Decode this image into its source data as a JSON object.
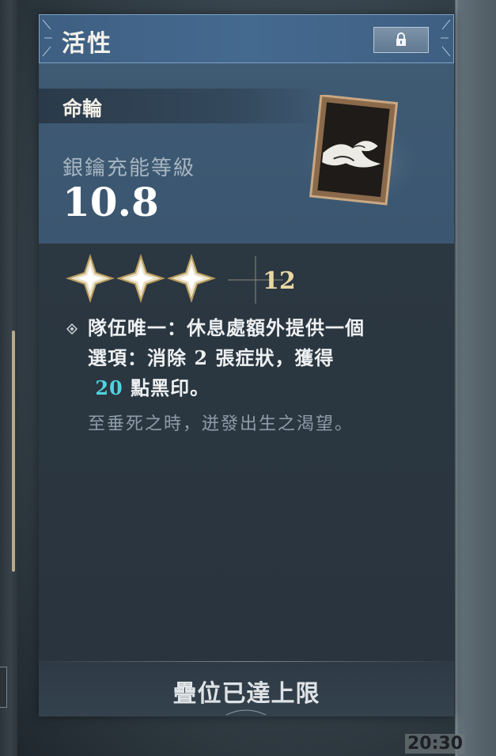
{
  "card": {
    "title": "活性",
    "type_label": "命輪",
    "charge_label": "銀鑰充能等級",
    "charge_value": "10.8",
    "stars": {
      "filled": 3,
      "count_label": "12"
    },
    "effect": {
      "line1": "隊伍唯一：休息處額外提供一個",
      "line2_a": "選項：消除 ",
      "line2_num": "2",
      "line2_b": " 張症狀，獲得",
      "line3_num": "20",
      "line3_b": " 點黑印。"
    },
    "flavor": "至垂死之時，迸發出生之渴望。",
    "footer": "疊位已達上限"
  },
  "icons": {
    "lock": "lock-icon",
    "frame": "framed-wave-painting-icon",
    "star": "four-point-star-icon",
    "bullet": "diamond-bullet-icon"
  },
  "colors": {
    "header": "#456a8f",
    "highlight": "#4fd3df",
    "star_count": "#e8d7a4"
  },
  "clock": "20:30"
}
